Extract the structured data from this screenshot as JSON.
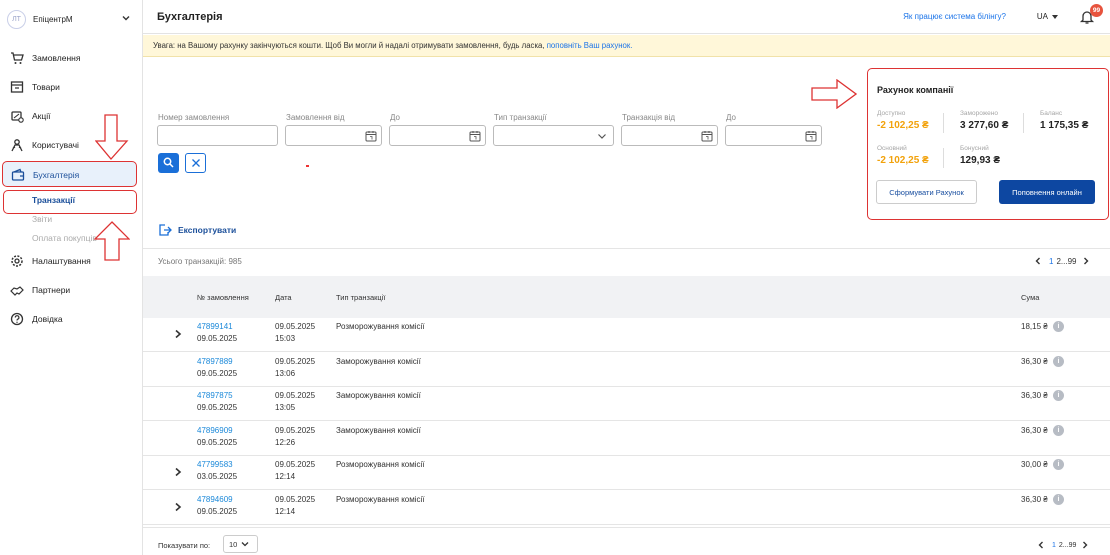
{
  "org": {
    "avatar": "ЛТ",
    "name": "ЕпіцентрМ"
  },
  "sidebar": {
    "items": [
      {
        "label": "Замовлення",
        "icon": "cart-icon"
      },
      {
        "label": "Товари",
        "icon": "store-icon"
      },
      {
        "label": "Акції",
        "icon": "discount-icon"
      },
      {
        "label": "Користувачі",
        "icon": "users-icon"
      },
      {
        "label": "Бухгалтерія",
        "icon": "wallet-icon"
      },
      {
        "label": "Налаштування",
        "icon": "gear-icon"
      },
      {
        "label": "Партнери",
        "icon": "handshake-icon"
      },
      {
        "label": "Довідка",
        "icon": "help-icon"
      }
    ],
    "sub": [
      "Транзакції",
      "Звіти",
      "Оплата покупців"
    ]
  },
  "header": {
    "title": "Бухгалтерія",
    "billing_link": "Як працює система білінгу?",
    "lang": "UA",
    "notifications": "99"
  },
  "warning": {
    "text": "Увага: на Вашому рахунку закінчуються кошти. Щоб Ви могли й надалі отримувати замовлення, будь ласка, ",
    "link": "поповніть Ваш рахунок."
  },
  "filters": {
    "order_number": "Номер замовлення",
    "order_from": "Замовлення від",
    "order_to": "До",
    "tx_type": "Тип транзакції",
    "tx_from": "Транзакція від",
    "tx_to": "До"
  },
  "account": {
    "title": "Рахунок компанії",
    "available_label": "Доступно",
    "available": "-2 102,25 ₴",
    "frozen_label": "Заморожено",
    "frozen": "3 277,60 ₴",
    "balance_label": "Баланс",
    "balance": "1 175,35 ₴",
    "main_label": "Основний",
    "main": "-2 102,25 ₴",
    "bonus_label": "Бонусний",
    "bonus": "129,93 ₴",
    "invoice_button": "Сформувати Рахунок",
    "topup_button": "Поповнення онлайн"
  },
  "export_label": "Експортувати",
  "table": {
    "total": "Усього транзакцій: 985",
    "pagination": {
      "current": "1",
      "rest": "2...99"
    },
    "columns": [
      "№ замовлення",
      "Дата",
      "Тип транзакції",
      "Сума"
    ],
    "rows": [
      {
        "order": "47899141",
        "order_date": "09.05.2025",
        "date": "09.05.2025",
        "time": "15:03",
        "type": "Розморожування комісії",
        "sum": "18,15 ₴",
        "expandable": true
      },
      {
        "order": "47897889",
        "order_date": "09.05.2025",
        "date": "09.05.2025",
        "time": "13:06",
        "type": "Заморожування комісії",
        "sum": "36,30 ₴",
        "expandable": false
      },
      {
        "order": "47897875",
        "order_date": "09.05.2025",
        "date": "09.05.2025",
        "time": "13:05",
        "type": "Заморожування комісії",
        "sum": "36,30 ₴",
        "expandable": false
      },
      {
        "order": "47896909",
        "order_date": "09.05.2025",
        "date": "09.05.2025",
        "time": "12:26",
        "type": "Заморожування комісії",
        "sum": "36,30 ₴",
        "expandable": false
      },
      {
        "order": "47799583",
        "order_date": "03.05.2025",
        "date": "09.05.2025",
        "time": "12:14",
        "type": "Розморожування комісії",
        "sum": "30,00 ₴",
        "expandable": true
      },
      {
        "order": "47894609",
        "order_date": "09.05.2025",
        "date": "09.05.2025",
        "time": "12:14",
        "type": "Розморожування комісії",
        "sum": "36,30 ₴",
        "expandable": true
      }
    ]
  },
  "footer": {
    "per_page_label": "Показувати по:",
    "per_page": "10",
    "pagination_current": "1",
    "pagination_rest": "2...99"
  },
  "colors": {
    "accent": "#1a6fd8",
    "warning": "#f2a20c",
    "annotation": "#dd3333"
  }
}
